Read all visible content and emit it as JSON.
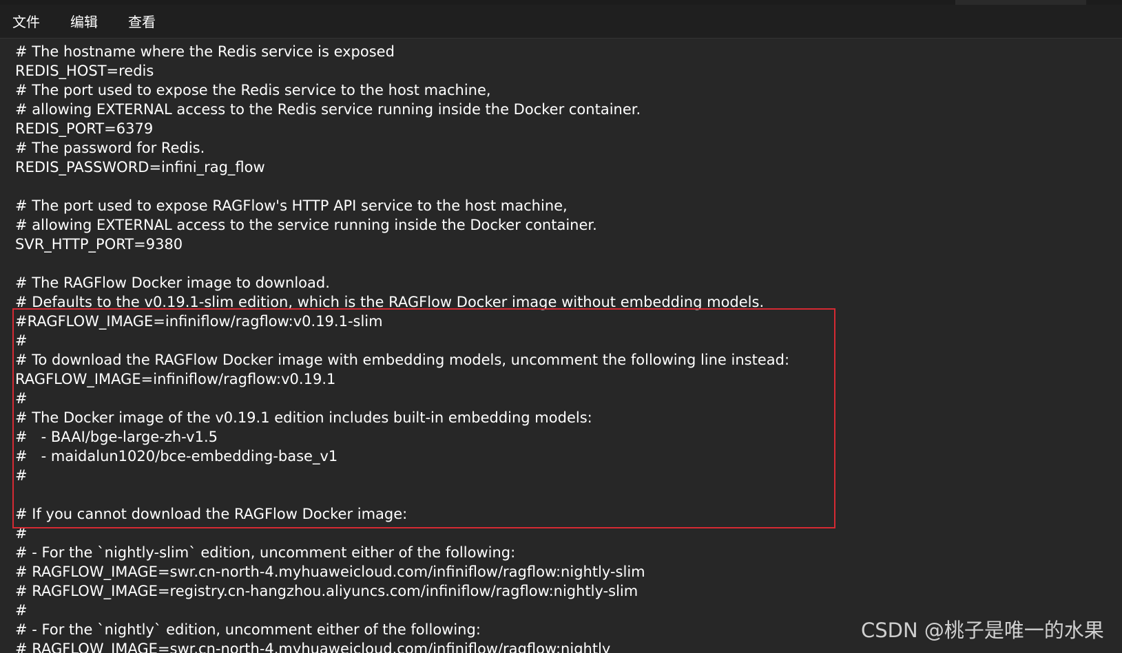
{
  "menu": {
    "file": "文件",
    "edit": "编辑",
    "view": "查看"
  },
  "editor": {
    "lines": [
      "# The hostname where the Redis service is exposed",
      "REDIS_HOST=redis",
      "# The port used to expose the Redis service to the host machine,",
      "# allowing EXTERNAL access to the Redis service running inside the Docker container.",
      "REDIS_PORT=6379",
      "# The password for Redis.",
      "REDIS_PASSWORD=infini_rag_flow",
      "",
      "# The port used to expose RAGFlow's HTTP API service to the host machine,",
      "# allowing EXTERNAL access to the service running inside the Docker container.",
      "SVR_HTTP_PORT=9380",
      "",
      "# The RAGFlow Docker image to download.",
      "# Defaults to the v0.19.1-slim edition, which is the RAGFlow Docker image without embedding models.",
      "#RAGFLOW_IMAGE=infiniflow/ragflow:v0.19.1-slim",
      "#",
      "# To download the RAGFlow Docker image with embedding models, uncomment the following line instead:",
      "RAGFLOW_IMAGE=infiniflow/ragflow:v0.19.1",
      "#",
      "# The Docker image of the v0.19.1 edition includes built-in embedding models:",
      "#   - BAAI/bge-large-zh-v1.5",
      "#   - maidalun1020/bce-embedding-base_v1",
      "#",
      "",
      "# If you cannot download the RAGFlow Docker image:",
      "#",
      "# - For the `nightly-slim` edition, uncomment either of the following:",
      "# RAGFLOW_IMAGE=swr.cn-north-4.myhuaweicloud.com/infiniflow/ragflow:nightly-slim",
      "# RAGFLOW_IMAGE=registry.cn-hangzhou.aliyuncs.com/infiniflow/ragflow:nightly-slim",
      "#",
      "# - For the `nightly` edition, uncomment either of the following:",
      "# RAGFLOW_IMAGE=swr.cn-north-4.myhuaweicloud.com/infiniflow/ragflow:nightly"
    ]
  },
  "watermark": "CSDN @桃子是唯一的水果",
  "colors": {
    "background": "#272727",
    "menubar": "#1f1f1f",
    "text": "#ffffff",
    "highlight_border": "#d62a33"
  }
}
